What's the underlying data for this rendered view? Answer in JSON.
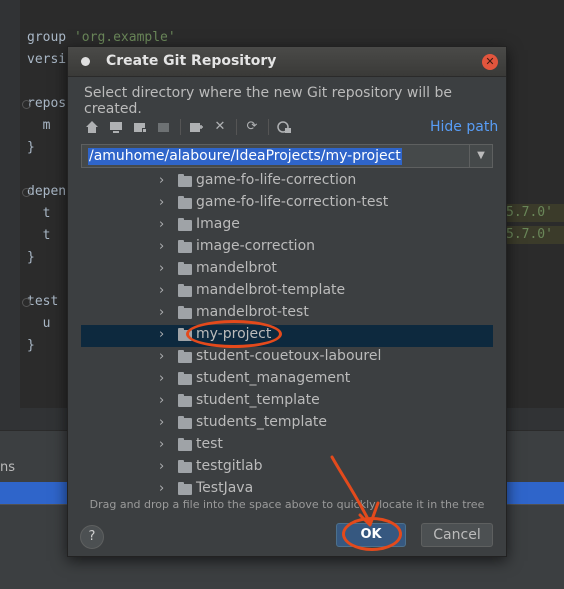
{
  "editor": {
    "lines": [
      {
        "prefix": "group ",
        "string": "'org.example'"
      },
      {
        "prefix": "versi",
        "string": ""
      },
      {
        "prefix": "repos",
        "string": ""
      },
      {
        "prefix": "  m",
        "string": ""
      },
      {
        "prefix": "}",
        "string": ""
      },
      {
        "prefix": "depen",
        "string": ""
      },
      {
        "prefix": "  t",
        "string": ""
      },
      {
        "prefix": "  t",
        "string": ""
      },
      {
        "prefix": "}",
        "string": ""
      },
      {
        "prefix": "test",
        "string": ""
      },
      {
        "prefix": "  u",
        "string": ""
      },
      {
        "prefix": "}",
        "string": ""
      }
    ],
    "right_strings": [
      "5.7.0'",
      "5.7.0'"
    ],
    "bottom_panel_text": "ns"
  },
  "dialog": {
    "title": "Create Git Repository",
    "close_icon": "close-icon",
    "description": "Select directory where the new Git repository will be created.",
    "toolbar": [
      "home-icon",
      "desktop-icon",
      "new-folder-icon",
      "folder-icon",
      "new-folder-plus-icon",
      "delete-icon",
      "refresh-icon",
      "show-hidden-icon"
    ],
    "hide_path_label": "Hide path",
    "path_value": "/amuhome/alaboure/IdeaProjects/my-project",
    "tree_items": [
      {
        "label": "game-fo-life-correction",
        "selected": false
      },
      {
        "label": "game-fo-life-correction-test",
        "selected": false
      },
      {
        "label": "Image",
        "selected": false
      },
      {
        "label": "image-correction",
        "selected": false
      },
      {
        "label": "mandelbrot",
        "selected": false
      },
      {
        "label": "mandelbrot-template",
        "selected": false
      },
      {
        "label": "mandelbrot-test",
        "selected": false
      },
      {
        "label": "my-project",
        "selected": true
      },
      {
        "label": "student-couetoux-labourel",
        "selected": false
      },
      {
        "label": "student_management",
        "selected": false
      },
      {
        "label": "student_template",
        "selected": false
      },
      {
        "label": "students_template",
        "selected": false
      },
      {
        "label": "test",
        "selected": false
      },
      {
        "label": "testgitlab",
        "selected": false
      },
      {
        "label": "TestJava",
        "selected": false
      }
    ],
    "hint": "Drag and drop a file into the space above to quickly locate it in the tree",
    "help_label": "?",
    "ok_label": "OK",
    "cancel_label": "Cancel"
  },
  "colors": {
    "accent": "#2f65ca",
    "ok_button": "#365880",
    "annotation": "#e34a1c"
  }
}
